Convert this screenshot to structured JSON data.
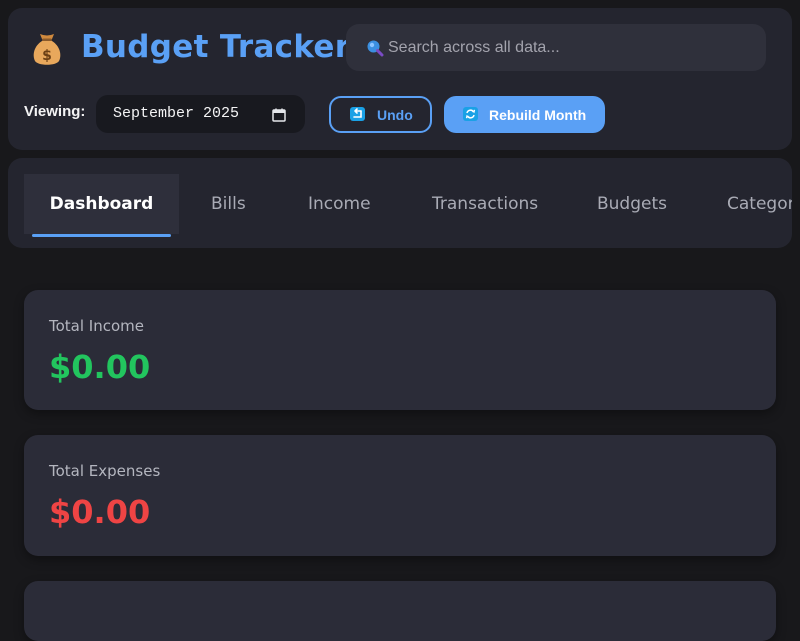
{
  "header": {
    "title": "Budget Tracker",
    "logo_icon": "money-bag-icon",
    "search": {
      "placeholder": "Search across all data...",
      "value": "",
      "icon": "search-icon"
    },
    "viewing_label": "Viewing:",
    "month_picker": {
      "value": "September 2025",
      "icon": "calendar-icon"
    },
    "undo_button": {
      "label": "Undo",
      "icon": "undo-icon"
    },
    "rebuild_button": {
      "label": "Rebuild Month",
      "icon": "refresh-icon"
    }
  },
  "tabs": [
    {
      "label": "Dashboard",
      "active": true
    },
    {
      "label": "Bills",
      "active": false
    },
    {
      "label": "Income",
      "active": false
    },
    {
      "label": "Transactions",
      "active": false
    },
    {
      "label": "Budgets",
      "active": false
    },
    {
      "label": "Categor",
      "active": false
    }
  ],
  "cards": [
    {
      "label": "Total Income",
      "value": "$0.00",
      "color": "#22c55e"
    },
    {
      "label": "Total Expenses",
      "value": "$0.00",
      "color": "#ef4444"
    }
  ],
  "colors": {
    "accent": "#5aa0f5",
    "background": "#18181b",
    "panel": "#24252f",
    "card": "#2b2c38",
    "income": "#22c55e",
    "expense": "#ef4444"
  }
}
